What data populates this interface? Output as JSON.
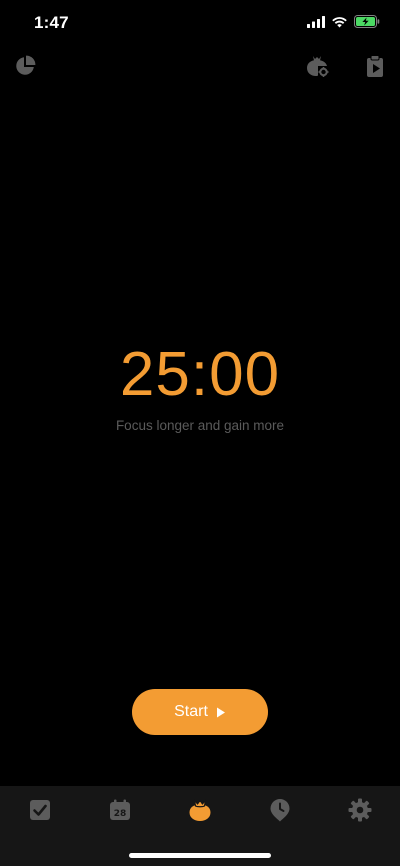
{
  "status_bar": {
    "time": "1:47"
  },
  "top_bar": {
    "left_icon": "pie-chart-icon",
    "right_icons": [
      "tomato-settings-icon",
      "clipboard-play-icon"
    ]
  },
  "timer": {
    "display": "25:00",
    "subtitle": "Focus longer and gain more"
  },
  "start_button": {
    "label": "Start",
    "icon": "play-icon"
  },
  "tab_bar": {
    "tabs": [
      {
        "icon": "check-square-icon",
        "active": false
      },
      {
        "icon": "calendar-icon",
        "day": "28",
        "active": false
      },
      {
        "icon": "tomato-icon",
        "active": true
      },
      {
        "icon": "location-clock-icon",
        "active": false
      },
      {
        "icon": "gear-icon",
        "active": false
      }
    ]
  },
  "colors": {
    "accent": "#f39c33",
    "background": "#000000",
    "tab_bar_bg": "#161616",
    "icon_inactive": "#5c5c5c",
    "subtitle_text": "#5b5b5b",
    "battery": "#4cd964"
  }
}
